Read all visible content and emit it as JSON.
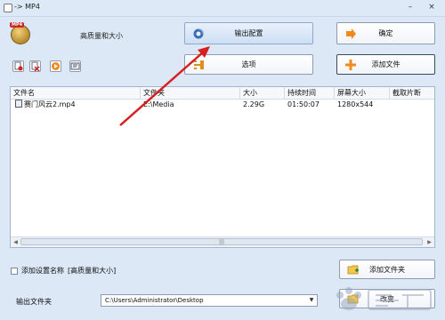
{
  "window": {
    "title": "-> MP4",
    "minimize": "–",
    "close": "×"
  },
  "profile": {
    "name": "高质量和大小"
  },
  "buttons": {
    "output_config": "输出配置",
    "ok": "确定",
    "options": "选项",
    "add_file": "添加文件",
    "add_folder": "添加文件夹",
    "change": "改变"
  },
  "toolbar": {
    "icons": [
      "remove-icon",
      "delete-icon",
      "play-icon",
      "info-icon"
    ]
  },
  "table": {
    "columns": [
      "文件名",
      "文件夹",
      "大小",
      "持续时间",
      "屏幕大小",
      "截取片断"
    ],
    "rows": [
      {
        "name": "赛门风云2.mp4",
        "folder": "E:\\Media",
        "size": "2.29G",
        "duration": "01:50:07",
        "screen": "1280x544",
        "clip": ""
      }
    ]
  },
  "bottom": {
    "checkbox_label": "添加设置名称",
    "checkbox_value": "[高质量和大小]",
    "output_folder_label": "输出文件夹",
    "output_folder_value": "C:\\Users\\Administrator\\Desktop"
  },
  "colors": {
    "window_bg": "#dce8f6",
    "annotation_arrow": "#d62020",
    "highlight_button": "#cddff4"
  },
  "watermark": {
    "text": "Baidu经验"
  }
}
